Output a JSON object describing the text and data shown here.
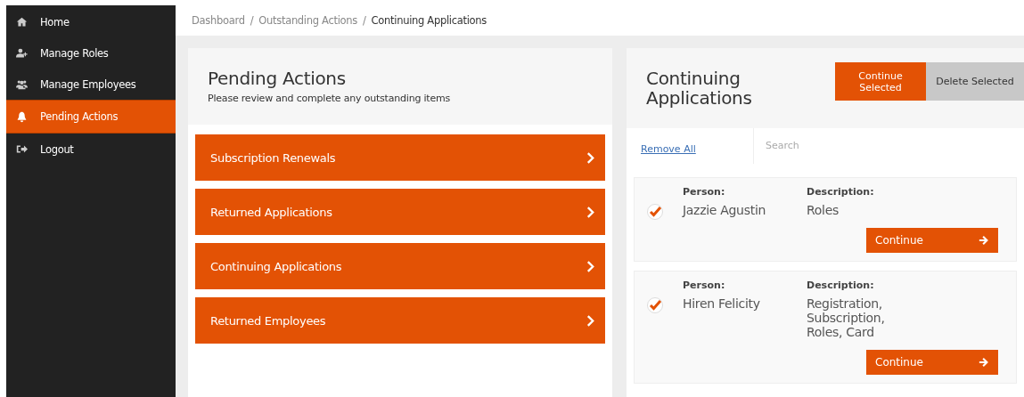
{
  "sidebar": {
    "items": [
      {
        "label": "Home",
        "selected": false
      },
      {
        "label": "Manage Roles",
        "selected": false
      },
      {
        "label": "Manage Employees",
        "selected": false
      },
      {
        "label": "Pending Actions",
        "selected": true
      },
      {
        "label": "Logout",
        "selected": false
      }
    ]
  },
  "breadcrumb": [
    {
      "label": "Dashboard"
    },
    {
      "separator": "/",
      "label": "Outstanding Actions"
    },
    {
      "separator": "/",
      "label": "Continuing Applications"
    }
  ],
  "pending": {
    "title": "Pending Actions",
    "subtitle": "Please review and complete any outstanding items",
    "items": [
      "Subscription Renewals",
      "Returned Applications",
      "Continuing Applications",
      "Returned Employees"
    ]
  },
  "continuing": {
    "title": "Continuing Applications",
    "continue_selected": "Continue Selected",
    "delete_selected": "Delete Selected",
    "remove_all": "Remove All",
    "search": {
      "placeholder": "Search"
    },
    "cards": [
      {
        "person_label": "Person:",
        "person": "Jazzie Agustin",
        "description_label": "Description:",
        "description": "Roles",
        "continue_label": "Continue",
        "checked": true
      },
      {
        "person_label": "Person:",
        "person": "Hiren Felicity",
        "description_label": "Description:",
        "description": "Registration, Subscription, Roles, Card",
        "continue_label": "Continue",
        "checked": true
      }
    ]
  }
}
